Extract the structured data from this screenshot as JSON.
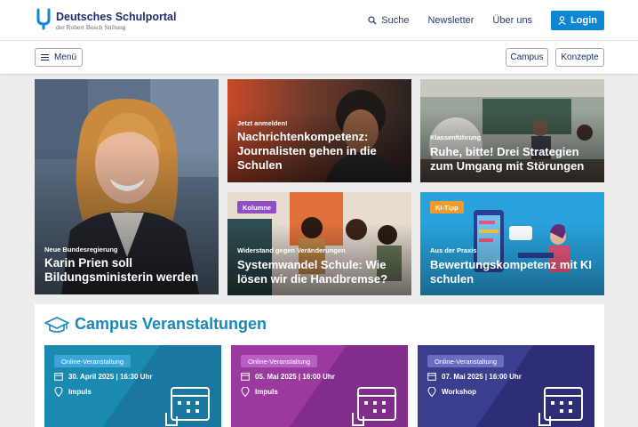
{
  "header": {
    "logo_title": "Deutsches Schulportal",
    "logo_subtitle": "der Robert Bosch Stiftung",
    "nav": {
      "search": "Suche",
      "newsletter": "Newsletter",
      "about": "Über uns",
      "login": "Login"
    }
  },
  "subbar": {
    "menu_label": "Menü",
    "campus_label": "Campus",
    "concepts_label": "Konzepte"
  },
  "tiles": [
    {
      "kicker": "Neue Bundesregierung",
      "title": "Karin Prien soll Bildungsministerin werden",
      "badge": ""
    },
    {
      "kicker": "Jetzt anmelden!",
      "title": "Nachrichtenkompetenz: Journalisten gehen in die Schulen",
      "badge": ""
    },
    {
      "kicker": "Klassenführung",
      "title": "Ruhe, bitte! Drei Strategien zum Umgang mit Störungen",
      "badge": ""
    },
    {
      "kicker": "Widerstand gegen Veränderungen",
      "title": "Systemwandel Schule: Wie lösen wir die Handbremse?",
      "badge": "Kolumne"
    },
    {
      "kicker": "Aus der Praxis",
      "title": "Bewertungskompetenz mit KI schulen",
      "badge": "KI-Tipp"
    }
  ],
  "campus": {
    "title": "Campus Veranstaltungen",
    "events": [
      {
        "tag": "Online-Veranstaltung",
        "date": "30. April 2025 | 16:30 Uhr",
        "type": "Impuls",
        "color": "#1b8ab0"
      },
      {
        "tag": "Online-Veranstaltung",
        "date": "05. Mai 2025 | 16:00 Uhr",
        "type": "Impuls",
        "color": "#9a3a9e"
      },
      {
        "tag": "Online-Veranstaltung",
        "date": "07. Mai 2025 | 16:00 Uhr",
        "type": "Workshop",
        "color": "#3b3d8f"
      }
    ]
  },
  "colors": {
    "brand_navy": "#1f2e6b",
    "brand_blue": "#0e86d6",
    "campus_teal": "#1a88b8",
    "badge_purple": "#8e4fc4",
    "badge_orange": "#f39a2a"
  }
}
